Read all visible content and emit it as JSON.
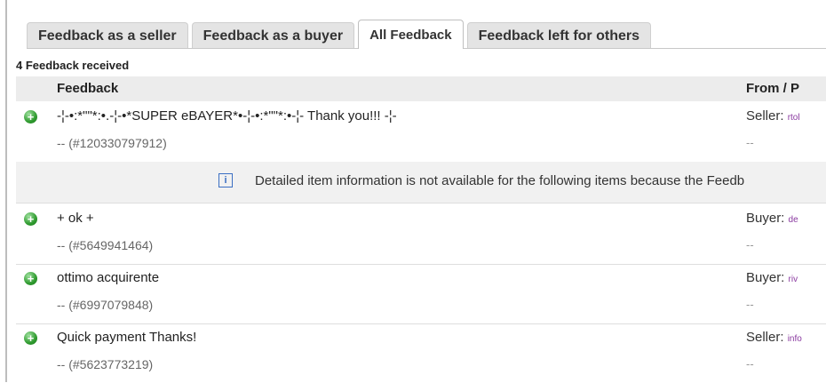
{
  "tabs": [
    "Feedback as a seller",
    "Feedback as a buyer",
    "All Feedback",
    "Feedback left for others"
  ],
  "active_tab": "All Feedback",
  "count_label": "4 Feedback received",
  "table": {
    "headers": {
      "feedback": "Feedback",
      "from": "From / P"
    }
  },
  "rows": [
    {
      "comment": "-¦-•:*\"\"*:•.-¦-•*SUPER eBAYER*•-¦-•:*\"\"*:•-¦- Thank you!!! -¦-",
      "item": "-- (#120330797912)",
      "role": "Seller:",
      "user": "rtol",
      "dash": "--"
    },
    {
      "comment": "+ ok +",
      "item": "-- (#5649941464)",
      "role": "Buyer:",
      "user": "de",
      "dash": "--"
    },
    {
      "comment": "ottimo acquirente",
      "item": "-- (#6997079848)",
      "role": "Buyer:",
      "user": "riv",
      "dash": "--"
    },
    {
      "comment": "Quick payment Thanks!",
      "item": "-- (#5623773219)",
      "role": "Seller:",
      "user": "info",
      "dash": "--"
    }
  ],
  "info": {
    "icon": "info-icon",
    "text": "Detailed item information is not available for the following items because the Feedb"
  },
  "icons": {
    "positive": "positive-feedback-icon"
  },
  "colors": {
    "positive": "#2e9a2e",
    "user_link": "#8a3aa0",
    "info_icon": "#3b6fc3"
  }
}
